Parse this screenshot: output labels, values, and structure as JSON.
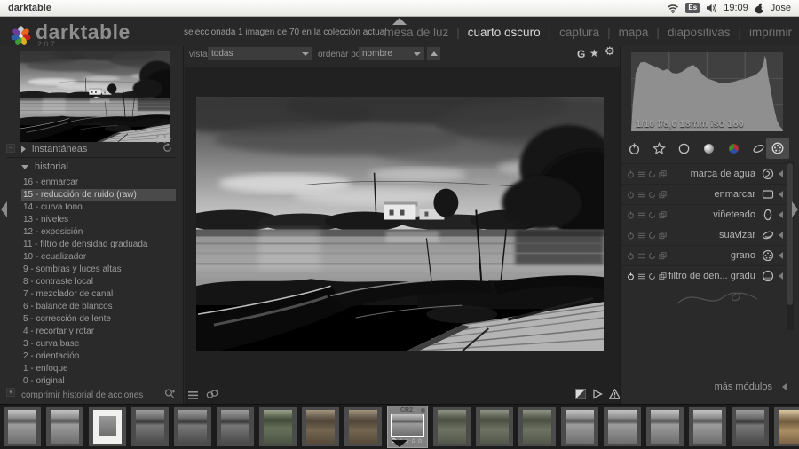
{
  "colors": {
    "menubar_bg": "#f0f0ee",
    "panel_bg": "#2a2a2a",
    "canvas_bg": "#212121",
    "text": "#9b9b9b",
    "text_bright": "#dadada",
    "selected_bg": "#4a4a4a",
    "filmstrip_bg": "#1c1c1c"
  },
  "menubar": {
    "app_title": "darktable",
    "keyboard_layout": "Es",
    "time": "19:09",
    "user": "Jose"
  },
  "header": {
    "app_name": "darktable",
    "version": "2.0.7",
    "selection_status": "seleccionada 1 imagen de 70 en la colección actual",
    "views": [
      {
        "label": "mesa de luz",
        "active": false
      },
      {
        "label": "cuarto oscuro",
        "active": true
      },
      {
        "label": "captura",
        "active": false
      },
      {
        "label": "mapa",
        "active": false
      },
      {
        "label": "diapositivas",
        "active": false
      },
      {
        "label": "imprimir",
        "active": false
      }
    ]
  },
  "filter_bar": {
    "view_label": "vista",
    "view_value": "todas",
    "sort_label": "ordenar por",
    "sort_value": "nombre",
    "group_button": "G",
    "overlays_icon": "star",
    "prefs_icon": "gear"
  },
  "left_panel": {
    "snapshots_title": "instantáneas",
    "history_title": "historial",
    "history_items": [
      {
        "label": "16 - enmarcar",
        "selected": false
      },
      {
        "label": "15 - reducción de ruido (raw)",
        "selected": true
      },
      {
        "label": "14 - curva tono",
        "selected": false
      },
      {
        "label": "13 - niveles",
        "selected": false
      },
      {
        "label": "12 - exposición",
        "selected": false
      },
      {
        "label": "11 - filtro de densidad graduada",
        "selected": false
      },
      {
        "label": "10 - ecualizador",
        "selected": false
      },
      {
        "label": "9 - sombras y luces altas",
        "selected": false
      },
      {
        "label": "8 - contraste local",
        "selected": false
      },
      {
        "label": "7 - mezclador de canal",
        "selected": false
      },
      {
        "label": "6 - balance de blancos",
        "selected": false
      },
      {
        "label": "5 - corrección de lente",
        "selected": false
      },
      {
        "label": "4 - recortar y rotar",
        "selected": false
      },
      {
        "label": "3 - curva base",
        "selected": false
      },
      {
        "label": "2 - orientación",
        "selected": false
      },
      {
        "label": "1 - enfoque",
        "selected": false
      },
      {
        "label": "0 - original",
        "selected": false
      }
    ],
    "compress_label": "comprimir historial de acciones"
  },
  "right_panel": {
    "histogram": {
      "exif_info": "1/10 f/8,0 18mm iso 160",
      "points": [
        [
          0,
          2
        ],
        [
          1,
          34
        ],
        [
          3,
          74
        ],
        [
          6,
          87
        ],
        [
          9,
          88
        ],
        [
          13,
          84
        ],
        [
          17,
          81
        ],
        [
          21,
          77
        ],
        [
          24,
          79
        ],
        [
          27,
          74
        ],
        [
          30,
          73
        ],
        [
          33,
          75
        ],
        [
          36,
          79
        ],
        [
          39,
          83
        ],
        [
          41,
          84
        ],
        [
          44,
          79
        ],
        [
          47,
          72
        ],
        [
          50,
          67
        ],
        [
          53,
          65
        ],
        [
          56,
          63
        ],
        [
          59,
          61
        ],
        [
          62,
          61
        ],
        [
          65,
          62
        ],
        [
          68,
          63
        ],
        [
          71,
          65
        ],
        [
          74,
          66
        ],
        [
          77,
          68
        ],
        [
          80,
          70
        ],
        [
          83,
          73
        ],
        [
          85,
          77
        ],
        [
          87,
          83
        ],
        [
          88,
          96
        ],
        [
          89,
          90
        ],
        [
          90,
          72
        ],
        [
          92,
          52
        ],
        [
          94,
          30
        ],
        [
          96,
          14
        ],
        [
          98,
          6
        ],
        [
          100,
          2
        ]
      ]
    },
    "module_groups": [
      "active",
      "favorites",
      "basic",
      "tone",
      "color",
      "correct",
      "effect"
    ],
    "active_group": "effect",
    "modules": [
      {
        "label": "marca de agua",
        "icon": "watermark",
        "enabled": false
      },
      {
        "label": "enmarcar",
        "icon": "frame",
        "enabled": false
      },
      {
        "label": "viñeteado",
        "icon": "vignette",
        "enabled": false
      },
      {
        "label": "suavizar",
        "icon": "soften",
        "enabled": false
      },
      {
        "label": "grano",
        "icon": "grain",
        "enabled": false
      },
      {
        "label": "filtro de den... graduada",
        "icon": "graduated",
        "enabled": true
      }
    ],
    "more_modules_label": "más módulos"
  },
  "filmstrip": {
    "selected_thumb": {
      "format_label": "CR2",
      "rating_stars": 4
    },
    "thumbs": [
      {
        "variant": "gray"
      },
      {
        "variant": "gray"
      },
      {
        "variant": "bright"
      },
      {
        "variant": "graydark"
      },
      {
        "variant": "graydark"
      },
      {
        "variant": "graydark"
      },
      {
        "variant": "green"
      },
      {
        "variant": "brown"
      },
      {
        "variant": "brown"
      },
      {
        "variant": "gray",
        "selected": true
      },
      {
        "variant": "sage"
      },
      {
        "variant": "sage"
      },
      {
        "variant": "sage"
      },
      {
        "variant": "gray"
      },
      {
        "variant": "gray"
      },
      {
        "variant": "gray"
      },
      {
        "variant": "gray"
      },
      {
        "variant": "graydark"
      },
      {
        "variant": "warm"
      }
    ]
  }
}
